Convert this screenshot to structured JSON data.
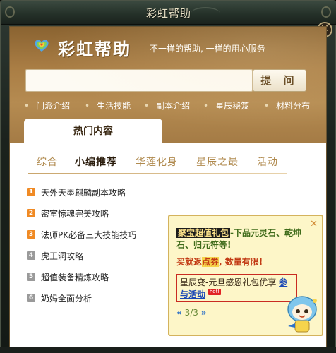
{
  "window": {
    "title": "彩虹帮助",
    "close_label": "✕"
  },
  "header": {
    "logo_icon": "rainbow-heart-icon",
    "logo_text": "彩虹帮助",
    "slogan": "不一样的帮助, 一样的用心服务"
  },
  "search": {
    "value": "",
    "placeholder": "",
    "button_label": "提 问"
  },
  "quick_links": [
    {
      "label": "门派介绍"
    },
    {
      "label": "生活技能"
    },
    {
      "label": "副本介绍"
    },
    {
      "label": "星辰秘笈"
    },
    {
      "label": "材料分布"
    }
  ],
  "hot_tab_label": "热门内容",
  "subtabs": [
    {
      "label": "综合"
    },
    {
      "label": "小编推荐"
    },
    {
      "label": "华莲化身"
    },
    {
      "label": "星辰之最"
    },
    {
      "label": "活动"
    }
  ],
  "active_subtab": "小编推荐",
  "list": [
    {
      "rank": "1",
      "label": "天外天墨麒麟副本攻略",
      "style": "hot"
    },
    {
      "rank": "2",
      "label": "密室惊魂完美攻略",
      "style": "hot"
    },
    {
      "rank": "3",
      "label": "法师PK必备三大技能技巧",
      "style": "hot"
    },
    {
      "rank": "4",
      "label": "虎王洞攻略",
      "style": "cold"
    },
    {
      "rank": "5",
      "label": "超值装备精炼攻略",
      "style": "cold"
    },
    {
      "rank": "6",
      "label": "奶妈全面分析",
      "style": "cold"
    }
  ],
  "popup": {
    "close_label": "✕",
    "title_highlight": "聚宝超值礼包",
    "title_rest": "-下品元灵石、乾坤石、归元符等!",
    "line2_a": "买就返",
    "line2_hl": "点券",
    "line2_b": ", 数量有限!",
    "box_text": "星辰变-元旦感恩礼包优享",
    "box_link": "参与活动",
    "hot_badge": "hot!",
    "pager_prev": "«",
    "pager_text": "3/3",
    "pager_next": "»",
    "mascot_icon": "mascot-icon"
  },
  "colors": {
    "banner": "#a97d44",
    "accent_orange": "#f08a24",
    "popup_bg": "#fdf6c8",
    "popup_border_red": "#c92b22",
    "link_blue": "#1b49b6"
  }
}
